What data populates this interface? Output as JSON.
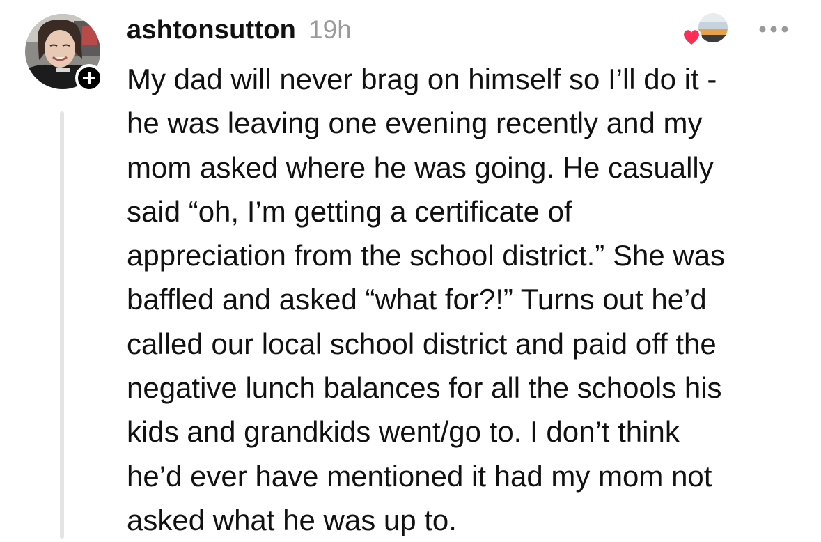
{
  "comment": {
    "username": "ashtonsutton",
    "timestamp": "19h",
    "text": "My dad will never brag on himself so I’ll do it -\nhe was leaving one evening recently and my\nmom asked where he was going. He casually\nsaid “oh, I’m getting a certificate of\nappreciation from the school district.” She was\nbaffled and asked “what for?!” Turns out he’d\ncalled our local school district and paid off the\nnegative lunch balances for all the schools his\nkids and grandkids went/go to. I don’t think\nhe’d ever have mentioned it had my mom not\nasked what he was up to.",
    "avatar_icon": "user-avatar-photo",
    "follow_icon": "plus-icon",
    "reaction_icon": "heart-icon",
    "more_icon": "ellipsis-icon"
  },
  "colors": {
    "text": "#111111",
    "muted": "#9a9a9a",
    "heart": "#ff2d55",
    "thread_line": "#e4e4e4"
  }
}
